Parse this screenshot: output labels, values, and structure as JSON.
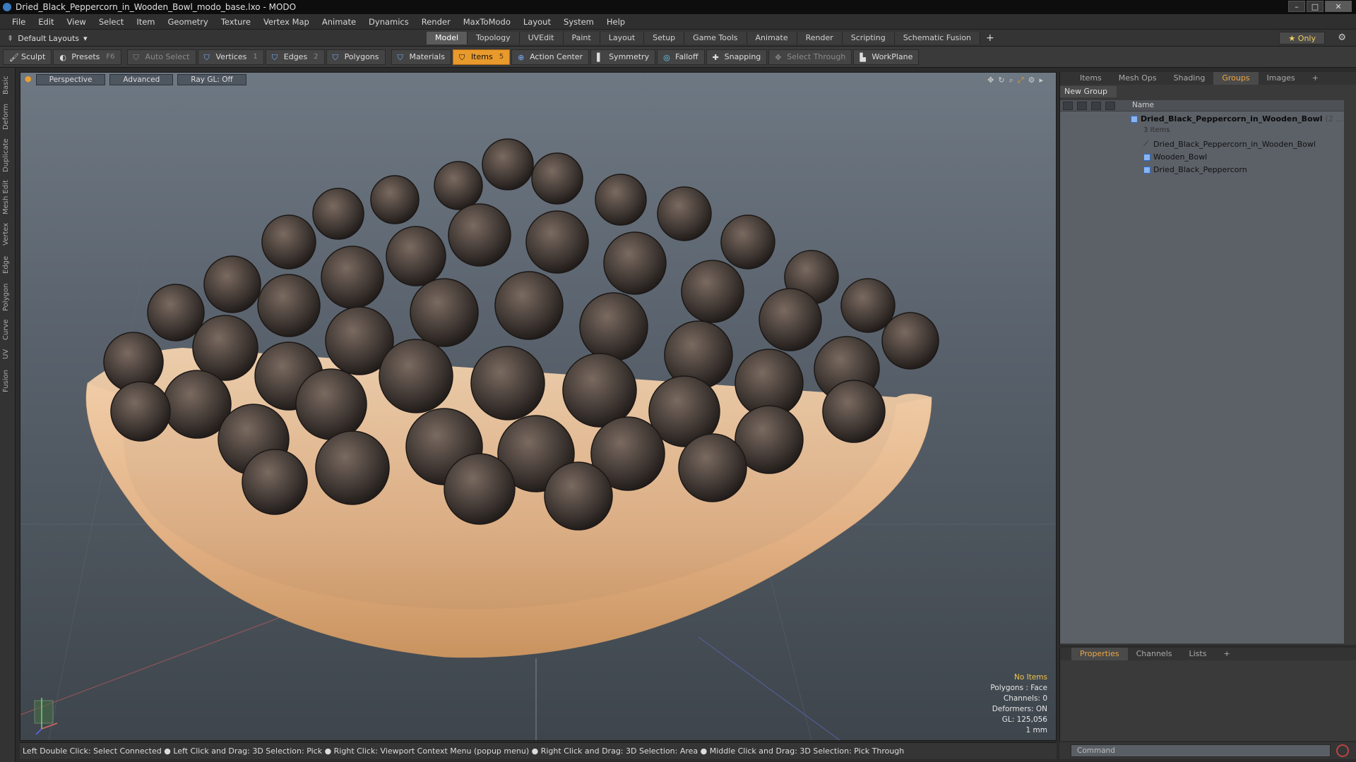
{
  "window": {
    "title": "Dried_Black_Peppercorn_in_Wooden_Bowl_modo_base.lxo - MODO"
  },
  "menu": [
    "File",
    "Edit",
    "View",
    "Select",
    "Item",
    "Geometry",
    "Texture",
    "Vertex Map",
    "Animate",
    "Dynamics",
    "Render",
    "MaxToModo",
    "Layout",
    "System",
    "Help"
  ],
  "layoutbar": {
    "selector": "Default Layouts",
    "tabs": [
      "Model",
      "Topology",
      "UVEdit",
      "Paint",
      "Layout",
      "Setup",
      "Game Tools",
      "Animate",
      "Render",
      "Scripting",
      "Schematic Fusion"
    ],
    "active_tab": "Model",
    "only_label": "Only"
  },
  "toolbar": {
    "sculpt": "Sculpt",
    "presets": "Presets",
    "presets_key": "F6",
    "auto_select": "Auto Select",
    "vertices": "Vertices",
    "vertices_count": "1",
    "edges": "Edges",
    "edges_count": "2",
    "polygons": "Polygons",
    "materials": "Materials",
    "items": "Items",
    "items_count": "5",
    "action_center": "Action Center",
    "symmetry": "Symmetry",
    "falloff": "Falloff",
    "snapping": "Snapping",
    "select_through": "Select Through",
    "workplane": "WorkPlane"
  },
  "left_tabs": [
    "Basic",
    "Deform",
    "Duplicate",
    "Mesh Edit",
    "Vertex",
    "Edge",
    "Polygon",
    "Curve",
    "UV",
    "Fusion"
  ],
  "viewport": {
    "view": "Perspective",
    "shading": "Advanced",
    "raygl": "Ray GL: Off",
    "info": {
      "no_items": "No Items",
      "polygons": "Polygons : Face",
      "channels": "Channels: 0",
      "deformers": "Deformers: ON",
      "gl": "GL: 125,056",
      "unit": "1 mm"
    }
  },
  "statusbar": "Left Double Click: Select Connected ● Left Click and Drag: 3D Selection: Pick ● Right Click: Viewport Context Menu (popup menu) ● Right Click and Drag: 3D Selection: Area ● Middle Click and Drag: 3D Selection: Pick Through",
  "right_panel": {
    "tabs": [
      "Items",
      "Mesh Ops",
      "Shading",
      "Groups",
      "Images"
    ],
    "active_tab": "Groups",
    "new_group": "New Group",
    "name_col": "Name",
    "group_name": "Dried_Black_Peppercorn_in_Wooden_Bowl",
    "group_suffix": "(2 ...",
    "group_count": "3 Items",
    "items": [
      "Dried_Black_Peppercorn_in_Wooden_Bowl",
      "Wooden_Bowl",
      "Dried_Black_Peppercorn"
    ]
  },
  "prop_panel": {
    "tabs": [
      "Properties",
      "Channels",
      "Lists"
    ],
    "active_tab": "Properties"
  },
  "command": {
    "placeholder": "Command"
  },
  "colors": {
    "accent": "#e89a2c",
    "active_tab_text": "#f0a640"
  }
}
